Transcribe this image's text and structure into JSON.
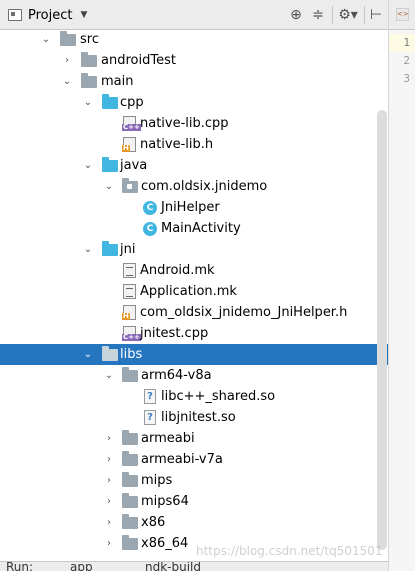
{
  "toolbar": {
    "project_label": "Project",
    "icons": [
      "target-icon",
      "collapse-all-icon",
      "gear-icon",
      "hide-panel-icon"
    ]
  },
  "tree": [
    {
      "label": "src",
      "icon": "folder"
    },
    {
      "label": "androidTest",
      "icon": "folder"
    },
    {
      "label": "main",
      "icon": "folder"
    },
    {
      "label": "cpp",
      "icon": "folder-blue"
    },
    {
      "label": "native-lib.cpp",
      "icon": "cpp-file"
    },
    {
      "label": "native-lib.h",
      "icon": "h-file"
    },
    {
      "label": "java",
      "icon": "folder-blue"
    },
    {
      "label": "com.oldsix.jnidemo",
      "icon": "package"
    },
    {
      "label": "JniHelper",
      "icon": "class",
      "badge": "C"
    },
    {
      "label": "MainActivity",
      "icon": "class",
      "badge": "C"
    },
    {
      "label": "jni",
      "icon": "folder-blue"
    },
    {
      "label": "Android.mk",
      "icon": "text-file"
    },
    {
      "label": "Application.mk",
      "icon": "text-file"
    },
    {
      "label": "com_oldsix_jnidemo_JniHelper.h",
      "icon": "h-file"
    },
    {
      "label": "jnitest.cpp",
      "icon": "cpp-file"
    },
    {
      "label": "libs",
      "icon": "folder"
    },
    {
      "label": "arm64-v8a",
      "icon": "folder"
    },
    {
      "label": "libc++_shared.so",
      "icon": "unknown-file"
    },
    {
      "label": "libjnitest.so",
      "icon": "unknown-file"
    },
    {
      "label": "armeabi",
      "icon": "folder"
    },
    {
      "label": "armeabi-v7a",
      "icon": "folder"
    },
    {
      "label": "mips",
      "icon": "folder"
    },
    {
      "label": "mips64",
      "icon": "folder"
    },
    {
      "label": "x86",
      "icon": "folder"
    },
    {
      "label": "x86_64",
      "icon": "folder"
    }
  ],
  "file_badges": {
    "cpp": "C++",
    "h": "H"
  },
  "gutter": {
    "lines": [
      "1",
      "2",
      "3"
    ],
    "file_badge": "<>"
  },
  "bottom": {
    "run_label": "Run:",
    "app_tab": "app",
    "ndk_tab": "ndk-build"
  },
  "watermark": "https://blog.csdn.net/tq501501",
  "colors": {
    "selection": "#2675bf",
    "folder_blue": "#40b6e0",
    "folder_gray": "#9aa7b0"
  }
}
